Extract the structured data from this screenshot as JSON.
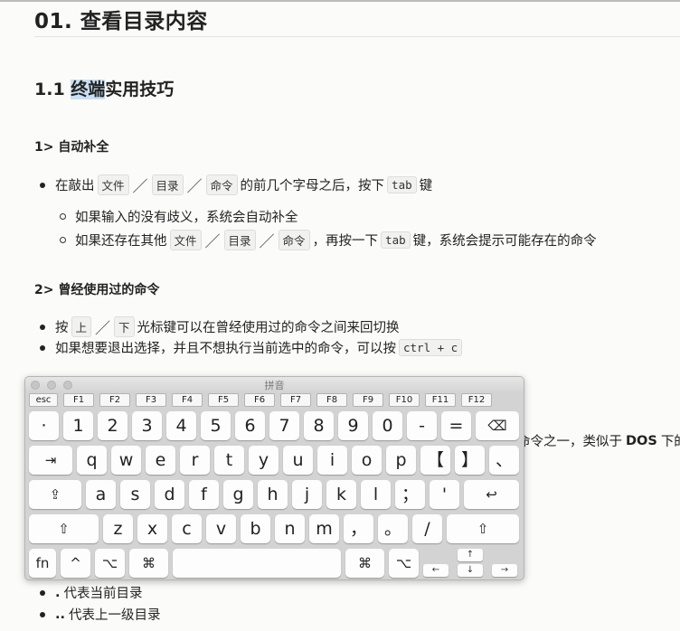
{
  "doc": {
    "title": "01. 查看目录内容",
    "section_prefix": "1.1 ",
    "section_highlight": "终端",
    "section_rest": "实用技巧",
    "sub1": "1> 自动补全",
    "b1": {
      "pre": "在敲出",
      "c1": "文件",
      "c2": "目录",
      "c3": "命令",
      "mid": "的前几个字母之后，按下",
      "c4": "tab",
      "post": "键"
    },
    "b1a": "如果输入的没有歧义，系统会自动补全",
    "b1b": {
      "pre": "如果还存在其他",
      "c1": "文件",
      "c2": "目录",
      "c3": "命令",
      "mid": "，再按一下",
      "c4": "tab",
      "post": "键，系统会提示可能存在的命令"
    },
    "sub2": "2> 曾经使用过的命令",
    "b2": {
      "pre": "按",
      "c1": "上",
      "c2": "下",
      "post": "光标键可以在曾经使用过的命令之间来回切换"
    },
    "b3": {
      "pre": "如果想要退出选择，并且不想执行当前选中的命令，可以按",
      "c1": "ctrl + c"
    },
    "partial": {
      "text": "命令之一，类似于",
      "bold": "DOS",
      "tail": "下的"
    },
    "b4": {
      "bold": ".",
      "text": "代表当前目录"
    },
    "b5": {
      "bold": "..",
      "text": "代表上一级目录"
    }
  },
  "keyboard": {
    "title": "拼音",
    "fn_row": [
      "esc",
      "F1",
      "F2",
      "F3",
      "F4",
      "F5",
      "F6",
      "F7",
      "F8",
      "F9",
      "F10",
      "F11",
      "F12"
    ],
    "row1": [
      "·",
      "1",
      "2",
      "3",
      "4",
      "5",
      "6",
      "7",
      "8",
      "9",
      "0",
      "-",
      "=",
      "⌫"
    ],
    "row2": [
      "⇥",
      "q",
      "w",
      "e",
      "r",
      "t",
      "y",
      "u",
      "i",
      "o",
      "p",
      "【",
      "】",
      "、"
    ],
    "row3": [
      "⇪",
      "a",
      "s",
      "d",
      "f",
      "g",
      "h",
      "j",
      "k",
      "l",
      "；",
      "'",
      "↩"
    ],
    "row4": [
      "⇧",
      "z",
      "x",
      "c",
      "v",
      "b",
      "n",
      "m",
      "，",
      "。",
      "/",
      "⇧"
    ],
    "row5": [
      "fn",
      "^",
      "⌥",
      "⌘",
      "",
      "⌘",
      "⌥"
    ],
    "arrows": {
      "up": "↑",
      "left": "←",
      "down": "↓",
      "right": "→"
    }
  }
}
